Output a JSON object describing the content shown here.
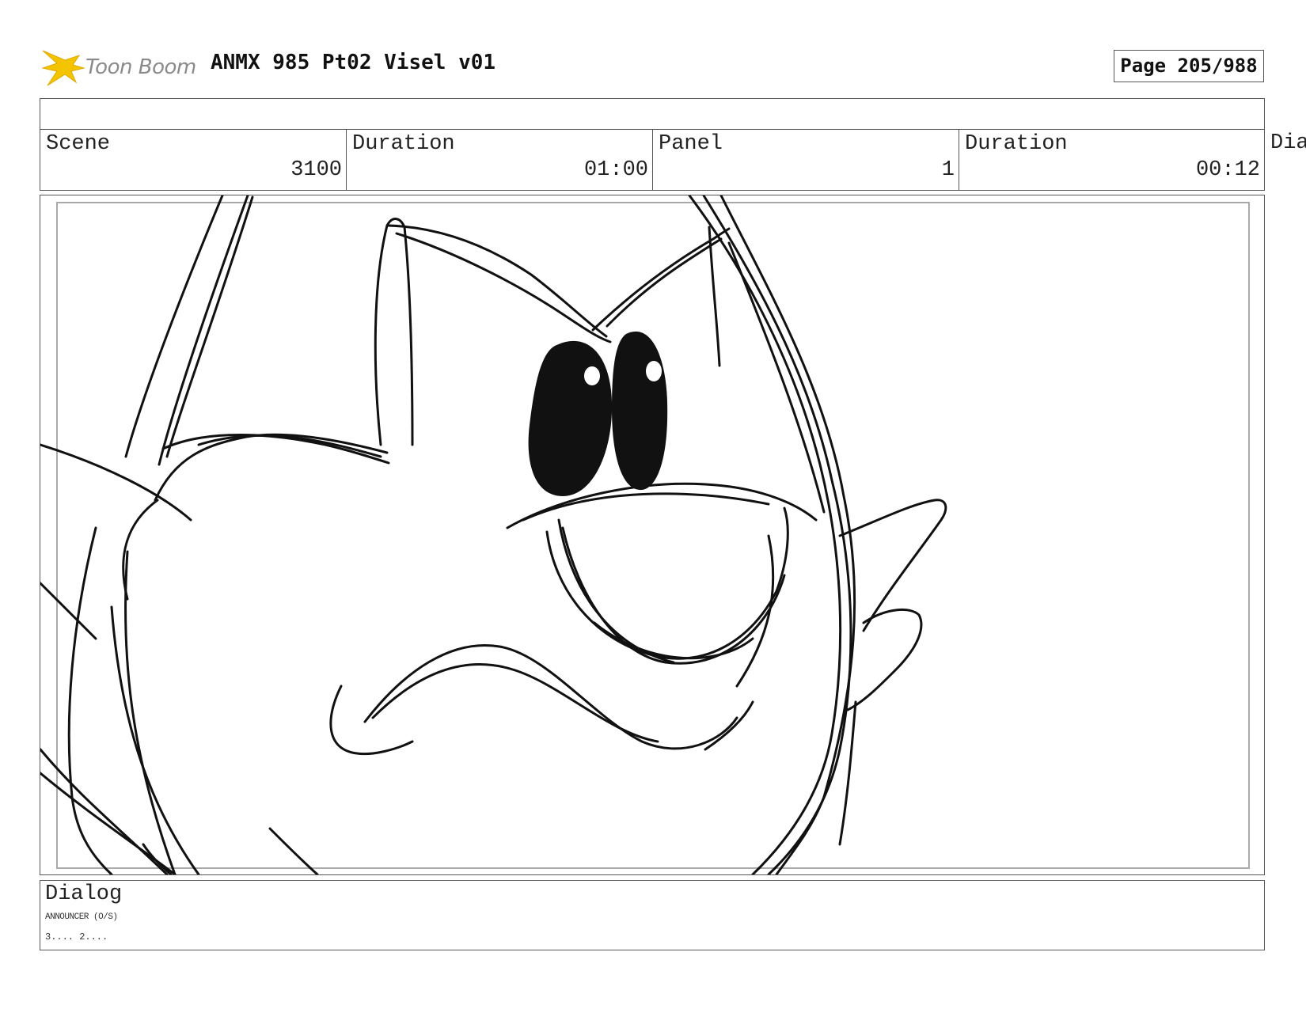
{
  "header": {
    "logo_text": "Toon Boom",
    "title": "ANMX 985 Pt02 Visel v01",
    "page": "Page 205/988"
  },
  "info": {
    "scene_label": "Scene",
    "scene_value": "3100",
    "scene_duration_label": "Duration",
    "scene_duration_value": "01:00",
    "panel_label": "Panel",
    "panel_value": "1",
    "panel_duration_label": "Duration",
    "panel_duration_value": "00:12",
    "overflow_label": "Dia"
  },
  "dialog": {
    "label": "Dialog",
    "speaker": "ANNOUNCER (O/S)",
    "line": "3.... 2...."
  },
  "colors": {
    "logo_accent": "#f5c400",
    "border": "#555555",
    "safe_area": "#aaaaaa"
  },
  "icons": {
    "logo": "toon-boom-starburst-icon"
  }
}
